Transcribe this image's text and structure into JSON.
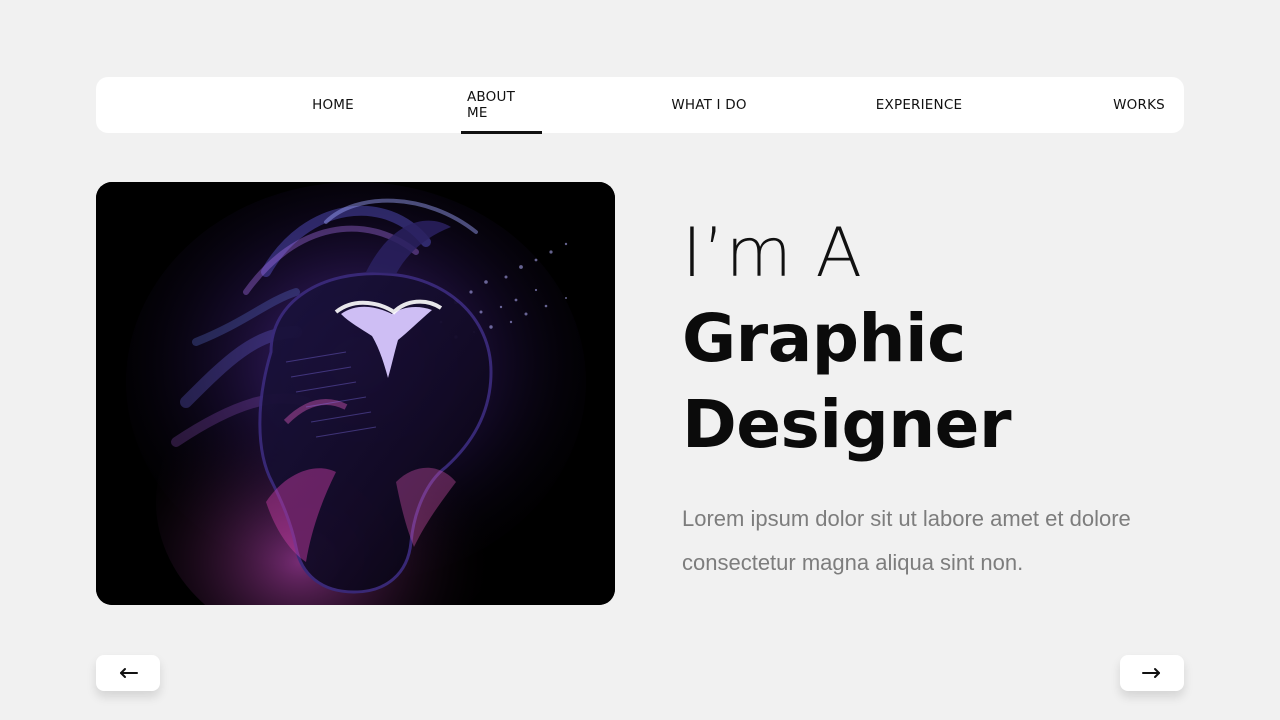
{
  "nav": {
    "items": [
      {
        "label": "HOME"
      },
      {
        "label": "ABOUT ME",
        "active": true
      },
      {
        "label": "WHAT I DO"
      },
      {
        "label": "EXPERIENCE"
      },
      {
        "label": "WORKS"
      }
    ]
  },
  "hero": {
    "line1": "I’m A",
    "line2": "Graphic",
    "line3": "Designer",
    "description": "Lorem ipsum dolor sit ut labore amet et dolore consectetur magna aliqua sint non."
  },
  "controls": {
    "prev_icon": "arrow-left-icon",
    "next_icon": "arrow-right-icon"
  },
  "colors": {
    "background": "#f1f1f1",
    "text": "#111111",
    "muted": "#7d7d7d",
    "accent_purple": "#8a4dff",
    "accent_pink": "#d64fd0"
  }
}
